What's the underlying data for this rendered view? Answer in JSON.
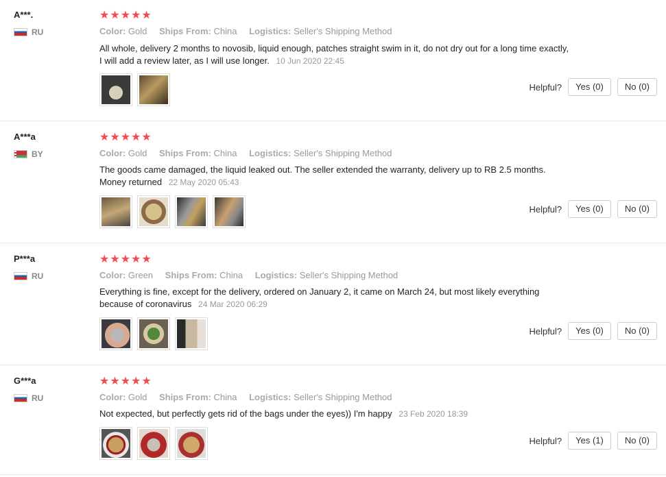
{
  "labels": {
    "color_key": "Color:",
    "ships_key": "Ships From:",
    "logistics_key": "Logistics:",
    "helpful": "Helpful?"
  },
  "reviews": [
    {
      "user": "A***.",
      "country": "RU",
      "rating": 5,
      "stars": "★★★★★",
      "color": "Gold",
      "ships_from": "China",
      "logistics": "Seller's Shipping Method",
      "text": "All whole, delivery 2 months to novosib, liquid enough, patches straight swim in it, do not dry out for a long time exactly, I will add a review later, as I will use longer.",
      "date": "10 Jun 2020 22:45",
      "photos": [
        "jar-photo",
        "box-photo"
      ],
      "yes": "Yes (0)",
      "no": "No (0)"
    },
    {
      "user": "A***a",
      "country": "BY",
      "rating": 5,
      "stars": "★★★★★",
      "color": "Gold",
      "ships_from": "China",
      "logistics": "Seller's Shipping Method",
      "text": "The goods came damaged, the liquid leaked out. The seller extended the warranty, delivery up to RB 2.5 months. Money returned",
      "date": "22 May 2020 05:43",
      "photos": [
        "box-photo",
        "jar-open-photo",
        "label-photo",
        "label-photo"
      ],
      "yes": "Yes (0)",
      "no": "No (0)"
    },
    {
      "user": "P***a",
      "country": "RU",
      "rating": 5,
      "stars": "★★★★★",
      "color": "Green",
      "ships_from": "China",
      "logistics": "Seller's Shipping Method",
      "text": "Everything is fine, except for the delivery, ordered on January 2, it came on March 24, but most likely everything because of coronavirus",
      "date": "24 Mar 2020 06:29",
      "photos": [
        "jar-hand-photo",
        "green-patches-photo",
        "jar-hand-photo"
      ],
      "yes": "Yes (0)",
      "no": "No (0)"
    },
    {
      "user": "G***a",
      "country": "RU",
      "rating": 5,
      "stars": "★★★★★",
      "color": "Gold",
      "ships_from": "China",
      "logistics": "Seller's Shipping Method",
      "text": "Not expected, but perfectly gets rid of the bags under the eyes)) I'm happy",
      "date": "23 Feb 2020 18:39",
      "photos": [
        "gold-patches-photo",
        "jar-lid-photo",
        "gold-jar-photo"
      ],
      "yes": "Yes (1)",
      "no": "No (0)"
    }
  ],
  "colors": {
    "star": "#f44c4c",
    "muted": "#999999",
    "divider": "#e8e8e8"
  }
}
